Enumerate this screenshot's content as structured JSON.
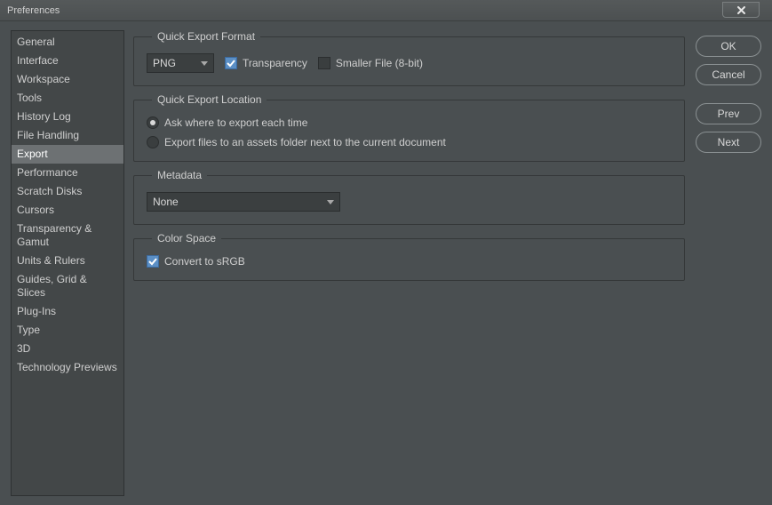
{
  "window": {
    "title": "Preferences"
  },
  "sidebar": {
    "items": [
      "General",
      "Interface",
      "Workspace",
      "Tools",
      "History Log",
      "File Handling",
      "Export",
      "Performance",
      "Scratch Disks",
      "Cursors",
      "Transparency & Gamut",
      "Units & Rulers",
      "Guides, Grid & Slices",
      "Plug-Ins",
      "Type",
      "3D",
      "Technology Previews"
    ],
    "active_index": 6
  },
  "groups": {
    "format": {
      "legend": "Quick Export Format",
      "format_value": "PNG",
      "transparency_label": "Transparency",
      "transparency_checked": true,
      "smaller_label": "Smaller File (8-bit)",
      "smaller_checked": false
    },
    "location": {
      "legend": "Quick Export Location",
      "opt_ask": "Ask where to export each time",
      "opt_assets": "Export files to an assets folder next to the current document",
      "selected": "ask"
    },
    "metadata": {
      "legend": "Metadata",
      "value": "None"
    },
    "colorspace": {
      "legend": "Color Space",
      "srgb_label": "Convert to sRGB",
      "srgb_checked": true
    }
  },
  "buttons": {
    "ok": "OK",
    "cancel": "Cancel",
    "prev": "Prev",
    "next": "Next"
  }
}
